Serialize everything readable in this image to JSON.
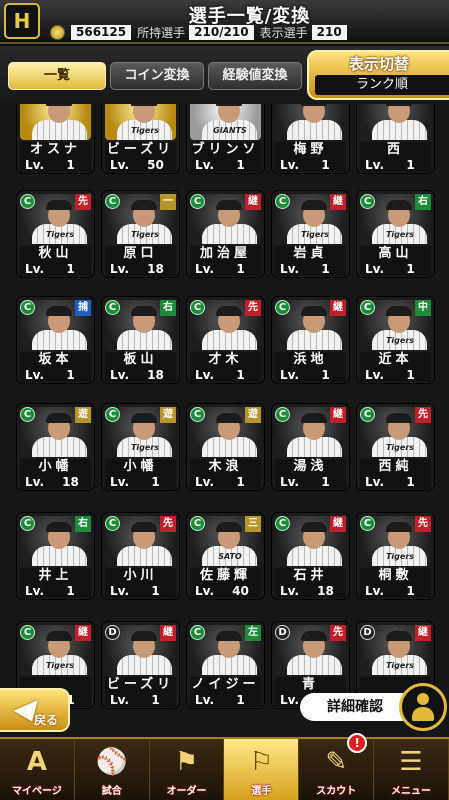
{
  "header": {
    "logo_text": "H",
    "title": "選手一覧/変換",
    "coins": "566125",
    "owned_label": "所持選手",
    "owned_value": "210/210",
    "shown_label": "表示選手",
    "shown_value": "210"
  },
  "tabs": [
    {
      "label": "一覧",
      "active": true
    },
    {
      "label": "コイン変換",
      "active": false
    },
    {
      "label": "経験値変換",
      "active": false
    }
  ],
  "display_toggle": {
    "label": "表示切替",
    "value": "ランク順"
  },
  "cards": [
    {
      "name": "オスナ",
      "lv": "1",
      "rank": "",
      "pos": "",
      "pos_color": "",
      "jersey": "",
      "rarity": "S"
    },
    {
      "name": "ビーズリー",
      "lv": "50",
      "rank": "",
      "pos": "",
      "pos_color": "",
      "jersey": "Tigers",
      "rarity": "S"
    },
    {
      "name": "ブリンソン",
      "lv": "1",
      "rank": "",
      "pos": "",
      "pos_color": "",
      "jersey": "GIANTS",
      "rarity": "A"
    },
    {
      "name": "梅野",
      "lv": "1",
      "rank": "",
      "pos": "",
      "pos_color": "",
      "jersey": "",
      "rarity": ""
    },
    {
      "name": "西",
      "lv": "1",
      "rank": "",
      "pos": "",
      "pos_color": "",
      "jersey": "",
      "rarity": ""
    },
    {
      "name": "秋山",
      "lv": "1",
      "rank": "C",
      "pos": "先",
      "pos_color": "#c0202a",
      "jersey": "Tigers",
      "rarity": ""
    },
    {
      "name": "原口",
      "lv": "18",
      "rank": "C",
      "pos": "一",
      "pos_color": "#b8952a",
      "jersey": "Tigers",
      "rarity": ""
    },
    {
      "name": "加治屋",
      "lv": "1",
      "rank": "C",
      "pos": "継",
      "pos_color": "#c0202a",
      "jersey": "",
      "rarity": ""
    },
    {
      "name": "岩貞",
      "lv": "1",
      "rank": "C",
      "pos": "継",
      "pos_color": "#c0202a",
      "jersey": "Tigers",
      "rarity": ""
    },
    {
      "name": "高山",
      "lv": "1",
      "rank": "C",
      "pos": "右",
      "pos_color": "#1e8b3a",
      "jersey": "Tigers",
      "rarity": ""
    },
    {
      "name": "坂本",
      "lv": "1",
      "rank": "C",
      "pos": "捕",
      "pos_color": "#1f5ec0",
      "jersey": "",
      "rarity": ""
    },
    {
      "name": "板山",
      "lv": "18",
      "rank": "C",
      "pos": "右",
      "pos_color": "#1e8b3a",
      "jersey": "",
      "rarity": ""
    },
    {
      "name": "才木",
      "lv": "1",
      "rank": "C",
      "pos": "先",
      "pos_color": "#c0202a",
      "jersey": "",
      "rarity": ""
    },
    {
      "name": "浜地",
      "lv": "1",
      "rank": "C",
      "pos": "継",
      "pos_color": "#c0202a",
      "jersey": "",
      "rarity": ""
    },
    {
      "name": "近本",
      "lv": "1",
      "rank": "C",
      "pos": "中",
      "pos_color": "#1e8b3a",
      "jersey": "Tigers",
      "rarity": ""
    },
    {
      "name": "小幡",
      "lv": "18",
      "rank": "C",
      "pos": "遊",
      "pos_color": "#b8952a",
      "jersey": "",
      "rarity": ""
    },
    {
      "name": "小幡",
      "lv": "1",
      "rank": "C",
      "pos": "遊",
      "pos_color": "#b8952a",
      "jersey": "Tigers",
      "rarity": ""
    },
    {
      "name": "木浪",
      "lv": "1",
      "rank": "C",
      "pos": "遊",
      "pos_color": "#b8952a",
      "jersey": "",
      "rarity": ""
    },
    {
      "name": "湯浅",
      "lv": "1",
      "rank": "C",
      "pos": "継",
      "pos_color": "#c0202a",
      "jersey": "",
      "rarity": ""
    },
    {
      "name": "西純",
      "lv": "1",
      "rank": "C",
      "pos": "先",
      "pos_color": "#c0202a",
      "jersey": "Tigers",
      "rarity": ""
    },
    {
      "name": "井上",
      "lv": "1",
      "rank": "C",
      "pos": "右",
      "pos_color": "#1e8b3a",
      "jersey": "",
      "rarity": ""
    },
    {
      "name": "小川",
      "lv": "1",
      "rank": "C",
      "pos": "先",
      "pos_color": "#c0202a",
      "jersey": "",
      "rarity": ""
    },
    {
      "name": "佐藤輝",
      "lv": "40",
      "rank": "C",
      "pos": "三",
      "pos_color": "#b8952a",
      "jersey": "SATO",
      "rarity": ""
    },
    {
      "name": "石井",
      "lv": "18",
      "rank": "C",
      "pos": "継",
      "pos_color": "#c0202a",
      "jersey": "",
      "rarity": ""
    },
    {
      "name": "桐敷",
      "lv": "1",
      "rank": "C",
      "pos": "先",
      "pos_color": "#c0202a",
      "jersey": "Tigers",
      "rarity": ""
    },
    {
      "name": "",
      "lv": "1",
      "rank": "C",
      "pos": "継",
      "pos_color": "#c0202a",
      "jersey": "Tigers",
      "rarity": ""
    },
    {
      "name": "ビーズリー",
      "lv": "1",
      "rank": "D",
      "pos": "継",
      "pos_color": "#c0202a",
      "jersey": "",
      "rarity": ""
    },
    {
      "name": "ノイジー",
      "lv": "1",
      "rank": "C",
      "pos": "左",
      "pos_color": "#1e8b3a",
      "jersey": "",
      "rarity": ""
    },
    {
      "name": "青",
      "lv": "1",
      "rank": "D",
      "pos": "先",
      "pos_color": "#c0202a",
      "jersey": "",
      "rarity": ""
    },
    {
      "name": "",
      "lv": "1",
      "rank": "D",
      "pos": "継",
      "pos_color": "#c0202a",
      "jersey": "Tigers",
      "rarity": ""
    }
  ],
  "lv_prefix": "Lv.",
  "back_button": {
    "label": "戻る"
  },
  "detail_button": {
    "label": "詳細確認"
  },
  "nav": [
    {
      "label": "マイページ",
      "icon": "A",
      "active": false,
      "badge": ""
    },
    {
      "label": "試合",
      "icon": "⚾",
      "active": false,
      "badge": ""
    },
    {
      "label": "オーダー",
      "icon": "⚑",
      "active": false,
      "badge": ""
    },
    {
      "label": "選手",
      "icon": "⚐",
      "active": true,
      "badge": ""
    },
    {
      "label": "スカウト",
      "icon": "✎",
      "active": false,
      "badge": "!"
    },
    {
      "label": "メニュー",
      "icon": "☰",
      "active": false,
      "badge": ""
    }
  ]
}
